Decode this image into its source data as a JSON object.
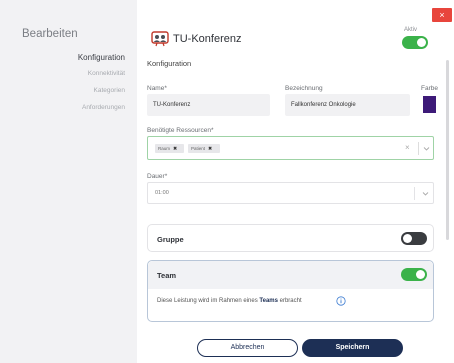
{
  "sidebar": {
    "title": "Bearbeiten",
    "items": [
      {
        "label": "Konfiguration",
        "active": true
      },
      {
        "label": "Konnektivität",
        "active": false
      },
      {
        "label": "Kategorien",
        "active": false
      },
      {
        "label": "Anforderungen",
        "active": false
      }
    ]
  },
  "header": {
    "title": "TU-Konferenz",
    "close_symbol": "×",
    "aktiv_label": "Aktiv",
    "aktiv_on": true
  },
  "form": {
    "section_title": "Konfiguration",
    "name_label": "Name*",
    "name_value": "TU-Konferenz",
    "bezeichnung_label": "Bezeichnung",
    "bezeichnung_value": "Fallkonferenz Onkologie",
    "farbe_label": "Farbe",
    "farbe_value": "#3d1a78",
    "ressourcen_label": "Benötigte Ressourcen*",
    "ressourcen_chips": [
      "Raum",
      "Patient"
    ],
    "chip_remove_symbol": "✖",
    "clear_symbol": "×",
    "dauer_label": "Dauer*",
    "dauer_value": "01:00"
  },
  "gruppe": {
    "label": "Gruppe",
    "on": false
  },
  "team": {
    "label": "Team",
    "on": true,
    "desc_before": "Diese Leistung wird im Rahmen eines ",
    "desc_bold": "Teams",
    "desc_after": " erbracht"
  },
  "buttons": {
    "cancel": "Abbrechen",
    "save": "Speichern"
  },
  "colors": {
    "accent": "#1d2f55",
    "toggle_on": "#3bb24a",
    "close": "#e8453c"
  },
  "icons": {
    "logo": "conference-people-icon",
    "info": "info-icon",
    "chevron": "chevron-down-icon"
  }
}
